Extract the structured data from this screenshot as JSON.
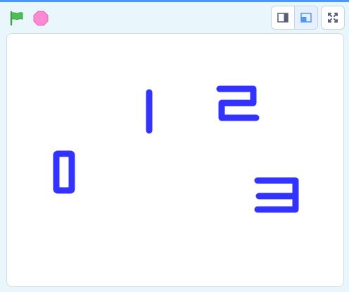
{
  "toolbar": {
    "green_flag": "green-flag-icon",
    "stop_sign": "stop-icon",
    "layout_small": "small-stage-icon",
    "layout_normal": "normal-stage-icon",
    "fullscreen": "fullscreen-icon"
  },
  "colors": {
    "accent_blue": "#4c97ff",
    "flag_green": "#4cbf56",
    "stop_pink": "#ff8ad4",
    "digit_blue": "#3333ff",
    "background": "#e9f7fd"
  },
  "stage": {
    "sprites": [
      {
        "name": "digit-0",
        "label": "0"
      },
      {
        "name": "digit-1",
        "label": "1"
      },
      {
        "name": "digit-2",
        "label": "2"
      },
      {
        "name": "digit-3",
        "label": "3"
      }
    ]
  }
}
